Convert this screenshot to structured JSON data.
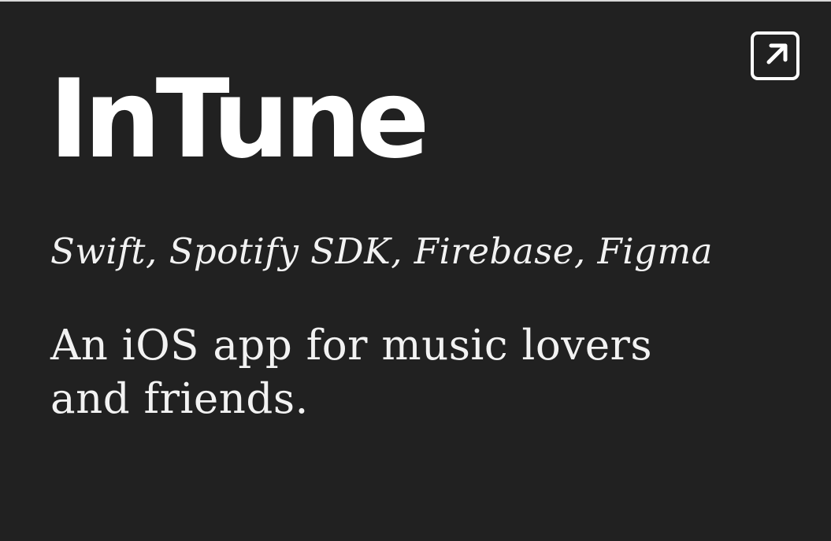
{
  "project": {
    "title": "InTune",
    "tech_stack": "Swift, Spotify SDK, Firebase, Figma",
    "description": "An iOS app for music lovers and friends.",
    "open_link_icon": "external-link-arrow-icon"
  },
  "colors": {
    "card_background": "#212121",
    "text": "#ffffff",
    "icon": "#ffffff"
  }
}
